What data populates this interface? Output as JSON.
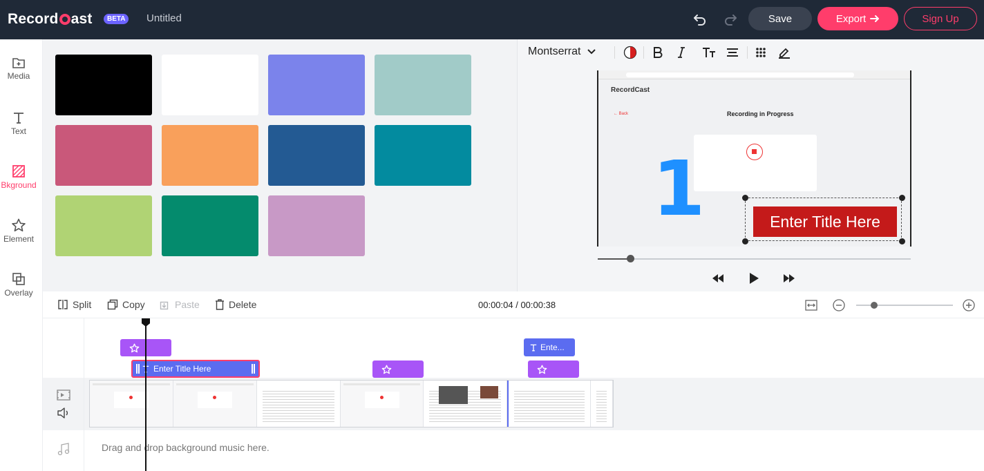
{
  "header": {
    "logo_text": "Record",
    "logo_text_end": "ast",
    "beta": "BETA",
    "doc_title": "Untitled",
    "save_label": "Save",
    "export_label": "Export",
    "signup_label": "Sign Up"
  },
  "sidebar": {
    "items": [
      {
        "label": "Media",
        "icon": "media-add-icon"
      },
      {
        "label": "Text",
        "icon": "text-icon"
      },
      {
        "label": "Bkground",
        "icon": "background-icon",
        "active": true
      },
      {
        "label": "Element",
        "icon": "star-icon"
      },
      {
        "label": "Overlay",
        "icon": "overlay-icon"
      }
    ]
  },
  "colors": {
    "swatches": [
      "#000000",
      "#ffffff",
      "#7b83eb",
      "#a1cbc8",
      "#c9587a",
      "#f9a05b",
      "#235a93",
      "#038b9f",
      "#b0d374",
      "#048b6d",
      "#c899c6"
    ],
    "accent": "#ff3d6b"
  },
  "preview_toolbar": {
    "font": "Montserrat"
  },
  "preview": {
    "canvas_logo": "RecordCast",
    "canvas_back": "← Back",
    "canvas_heading": "Recording in Progress",
    "big_number": "1",
    "title_text": "Enter Title Here"
  },
  "edit_bar": {
    "split": "Split",
    "copy": "Copy",
    "paste": "Paste",
    "delete": "Delete",
    "timecode": "00:00:04 / 00:00:38"
  },
  "timeline": {
    "text_clip_label": "Enter Title Here",
    "text_clip_2_label": "Ente...",
    "music_placeholder": "Drag and drop background music here."
  }
}
